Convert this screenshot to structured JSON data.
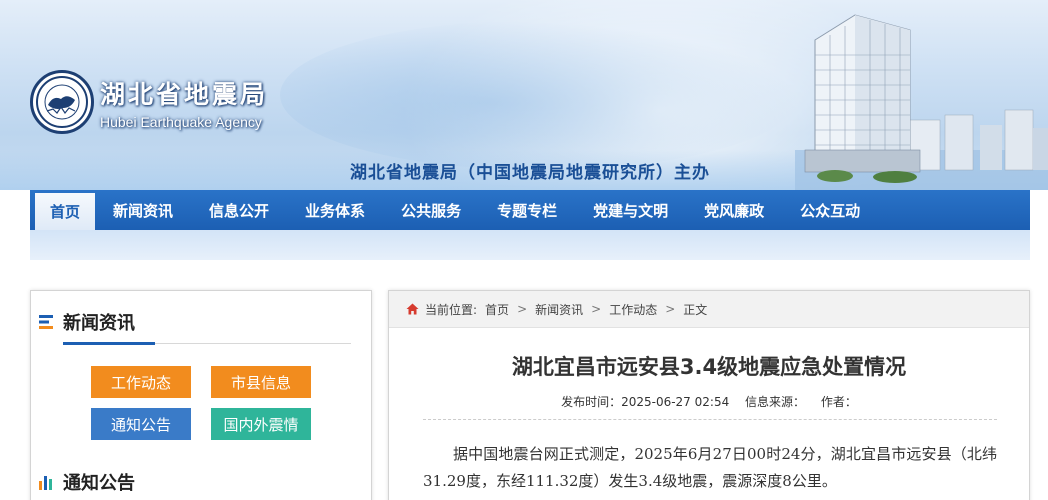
{
  "header": {
    "logo_cn": "湖北省地震局",
    "logo_en": "Hubei Earthquake Agency",
    "host_line": "湖北省地震局（中国地震局地震研究所）主办"
  },
  "nav": {
    "items": [
      {
        "label": "首页",
        "active": true
      },
      {
        "label": "新闻资讯"
      },
      {
        "label": "信息公开"
      },
      {
        "label": "业务体系"
      },
      {
        "label": "公共服务"
      },
      {
        "label": "专题专栏"
      },
      {
        "label": "党建与文明"
      },
      {
        "label": "党风廉政"
      },
      {
        "label": "公众互动"
      }
    ]
  },
  "sidebar": {
    "news_title": "新闻资讯",
    "tags": [
      {
        "label": "工作动态",
        "color": "#f28c1e"
      },
      {
        "label": "市县信息",
        "color": "#f28c1e"
      },
      {
        "label": "通知公告",
        "color": "#3a7bc8"
      },
      {
        "label": "国内外震情",
        "color": "#2fb59a"
      }
    ],
    "notice_title": "通知公告"
  },
  "breadcrumb": {
    "prefix": "当前位置:",
    "items": [
      "首页",
      "新闻资讯",
      "工作动态",
      "正文"
    ]
  },
  "article": {
    "title": "湖北宜昌市远安县3.4级地震应急处置情况",
    "publish_time": "发布时间：2025-06-27 02:54",
    "source": "信息来源：",
    "author": "作者：",
    "paragraph": "据中国地震台网正式测定，2025年6月27日00时24分，湖北宜昌市远安县（北纬31.29度，东经111.32度）发生3.4级地震，震源深度8公里。"
  },
  "colors": {
    "nav_blue": "#1c5fb3",
    "tag_orange": "#f28c1e",
    "tag_blue": "#3a7bc8",
    "tag_teal": "#2fb59a",
    "home_icon_red": "#d63b2f"
  }
}
